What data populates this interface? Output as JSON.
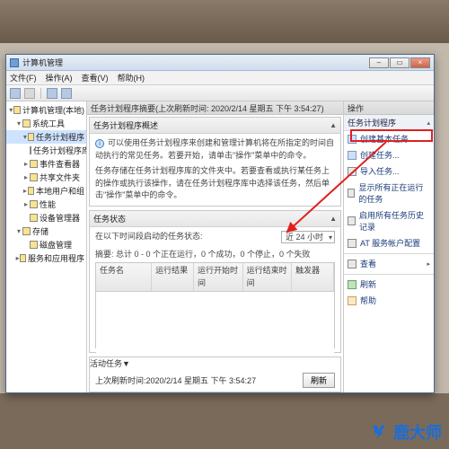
{
  "window": {
    "title": "计算机管理",
    "controls": {
      "min": "–",
      "max": "▭",
      "close": "×"
    }
  },
  "menu": {
    "file": "文件(F)",
    "action": "操作(A)",
    "view": "查看(V)",
    "help": "帮助(H)"
  },
  "tree": {
    "root": "计算机管理(本地)",
    "sys_tools": "系统工具",
    "task_sched": "任务计划程序",
    "task_lib": "任务计划程序库",
    "event_viewer": "事件查看器",
    "shared": "共享文件夹",
    "users": "本地用户和组",
    "perf": "性能",
    "devmgr": "设备管理器",
    "storage": "存储",
    "diskmgr": "磁盘管理",
    "services": "服务和应用程序"
  },
  "mid": {
    "header": "任务计划程序摘要(上次刷新时间: 2020/2/14 星期五 下午 3:54:27)",
    "overview_title": "任务计划程序概述",
    "overview_line1": "可以使用任务计划程序来创建和管理计算机将在所指定的时间自动执行的常见任务。若要开始，请单击\"操作\"菜单中的命令。",
    "overview_line2": "任务存储在任务计划程序库的文件夹中。若要查看或执行某任务上的操作或执行该操作，请在任务计划程序库中选择该任务，然后单击\"操作\"菜单中的命令。",
    "status_title": "任务状态",
    "status_range_label": "在以下时间段启动的任务状态:",
    "status_summary": "摘要: 总计 0 - 0 个正在运行，0 个成功，0 个停止，0 个失败",
    "range_value": "近 24 小时",
    "cols": {
      "name": "任务名",
      "result": "运行结果",
      "start": "运行开始时间",
      "end": "运行结束时间",
      "trigger": "触发器"
    },
    "active_title": "活动任务",
    "refresh_time": "上次刷新时间:2020/2/14 星期五 下午 3:54:27",
    "refresh_btn": "刷新"
  },
  "actions": {
    "head": "操作",
    "section": "任务计划程序",
    "create_basic": "创建基本任务...",
    "create_task": "创建任务...",
    "import": "导入任务...",
    "show_running": "显示所有正在运行的任务",
    "history": "启用所有任务历史记录",
    "at_svc": "AT 服务帐户配置",
    "view": "查看",
    "refresh": "刷新",
    "help": "帮助"
  },
  "watermark": "鹿大师",
  "colors": {
    "highlight_red": "#e02020",
    "link_blue": "#1a3a7a"
  }
}
